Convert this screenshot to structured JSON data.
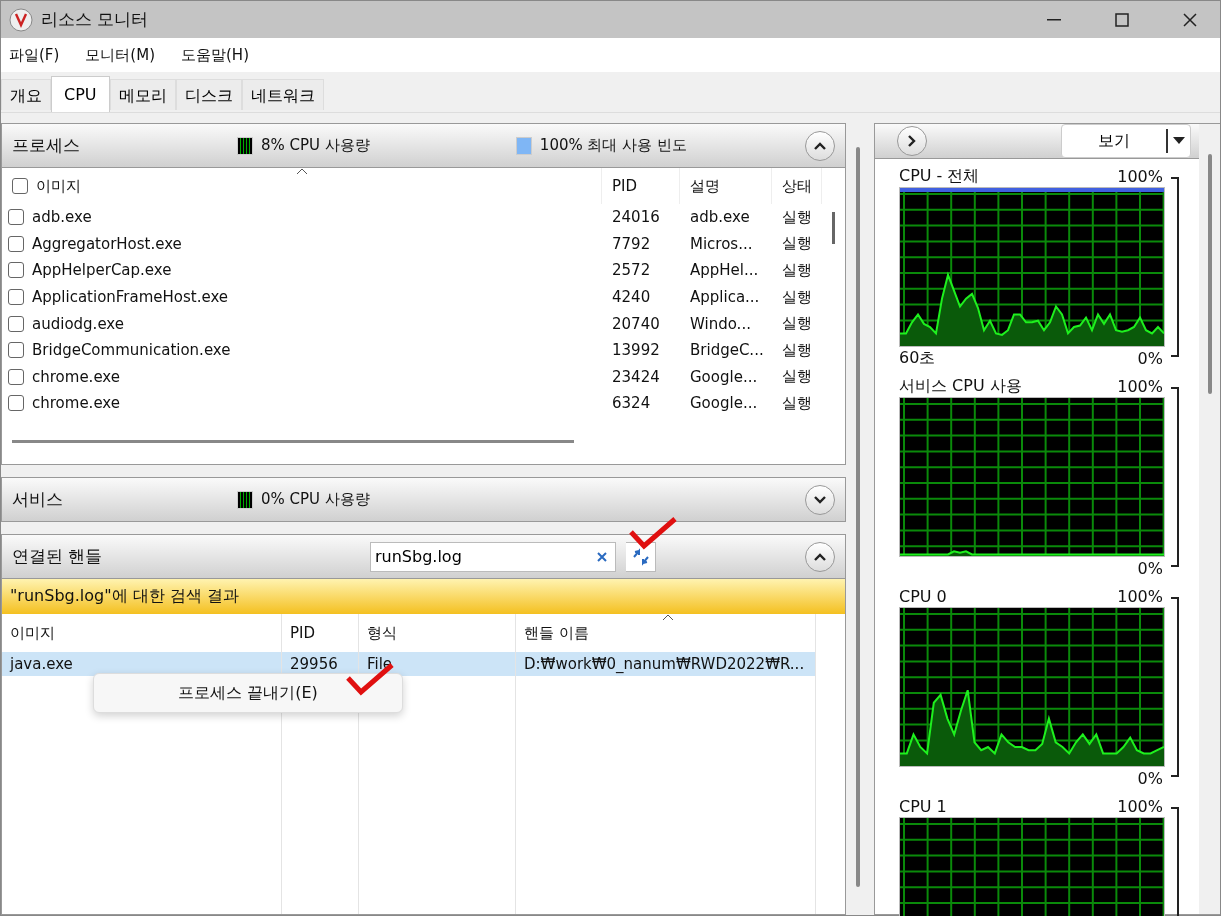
{
  "window": {
    "title": "리소스 모니터"
  },
  "menu": [
    "파일(F)",
    "모니터(M)",
    "도움말(H)"
  ],
  "tabs": [
    {
      "label": "개요",
      "selected": false
    },
    {
      "label": "CPU",
      "selected": true
    },
    {
      "label": "메모리",
      "selected": false
    },
    {
      "label": "디스크",
      "selected": false
    },
    {
      "label": "네트워크",
      "selected": false
    }
  ],
  "processes": {
    "title": "프로세스",
    "usage": "8% CPU 사용량",
    "frequency": "100% 최대 사용 빈도",
    "expanded": true,
    "columns": [
      "이미지",
      "PID",
      "설명",
      "상태"
    ],
    "rows": [
      {
        "image": "adb.exe",
        "pid": "24016",
        "description": "adb.exe",
        "status": "실행",
        "checked": false
      },
      {
        "image": "AggregatorHost.exe",
        "pid": "7792",
        "description": "Micros...",
        "status": "실행",
        "checked": false
      },
      {
        "image": "AppHelperCap.exe",
        "pid": "2572",
        "description": "AppHel...",
        "status": "실행",
        "checked": false
      },
      {
        "image": "ApplicationFrameHost.exe",
        "pid": "4240",
        "description": "Applica...",
        "status": "실행",
        "checked": false
      },
      {
        "image": "audiodg.exe",
        "pid": "20740",
        "description": "Windo...",
        "status": "실행",
        "checked": false
      },
      {
        "image": "BridgeCommunication.exe",
        "pid": "13992",
        "description": "BridgeC...",
        "status": "실행",
        "checked": false
      },
      {
        "image": "chrome.exe",
        "pid": "23424",
        "description": "Google...",
        "status": "실행",
        "checked": false
      },
      {
        "image": "chrome.exe",
        "pid": "6324",
        "description": "Google...",
        "status": "실행",
        "checked": false
      }
    ]
  },
  "services": {
    "title": "서비스",
    "usage": "0% CPU 사용량",
    "expanded": false
  },
  "handles": {
    "title": "연결된 핸들",
    "search": "runSbg.log",
    "expanded": true,
    "result_banner": "\"runSbg.log\"에 대한 검색 결과",
    "columns": [
      "이미지",
      "PID",
      "형식",
      "핸들 이름"
    ],
    "rows": [
      {
        "image": "java.exe",
        "pid": "29956",
        "type": "File",
        "handle_name": "D:₩work₩0_nanum₩RWD2022₩R...",
        "selected": true
      }
    ]
  },
  "context_menu": [
    "프로세스 끝내기(E)"
  ],
  "monitor": {
    "view_button": "보기",
    "graphs": [
      {
        "title": "CPU - 전체",
        "max": "100%",
        "min": "0%",
        "time": "60초"
      },
      {
        "title": "서비스 CPU 사용",
        "max": "100%",
        "min": "0%"
      },
      {
        "title": "CPU 0",
        "max": "100%",
        "min": "0%"
      },
      {
        "title": "CPU 1",
        "max": "100%"
      }
    ]
  }
}
